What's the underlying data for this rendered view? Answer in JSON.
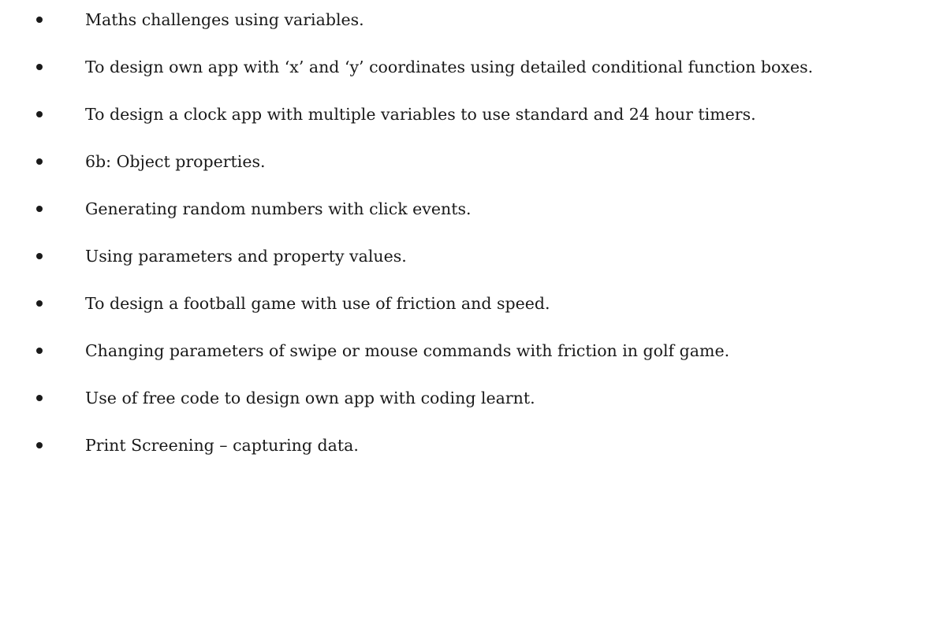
{
  "document": {
    "bullets": [
      "Maths challenges using variables.",
      "To design own app with ‘x’ and ‘y’ coordinates using detailed conditional function boxes.",
      "To design a clock app with multiple variables to use standard and 24 hour timers.",
      "6b: Object properties.",
      "Generating random numbers with click events.",
      "Using parameters and property values.",
      "To design a football game with use of friction and speed.",
      "Changing parameters of swipe or mouse commands with friction in golf game.",
      "Use of free code to design own app with coding learnt.",
      "Print Screening – capturing data."
    ]
  }
}
